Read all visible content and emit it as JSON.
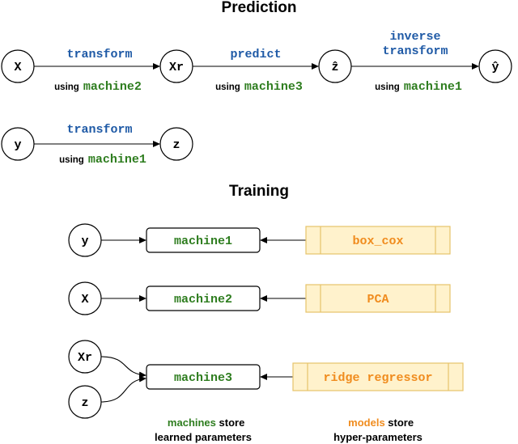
{
  "colors": {
    "operation": "#1f5aa6",
    "machine": "#2e7d1f",
    "model": "#f08c1e",
    "model_fill": "#fff2cc",
    "model_border": "#e6c36a"
  },
  "prediction": {
    "title": "Prediction",
    "row1": {
      "nodes": [
        "X",
        "Xr",
        "ẑ",
        "ŷ"
      ],
      "edges": [
        {
          "op": "transform",
          "using": "using",
          "machine": "machine2"
        },
        {
          "op": "predict",
          "using": "using",
          "machine": "machine3"
        },
        {
          "op_line1": "inverse",
          "op_line2": "transform",
          "using": "using",
          "machine": "machine1"
        }
      ]
    },
    "row2": {
      "nodes": [
        "y",
        "z"
      ],
      "edges": [
        {
          "op": "transform",
          "using": "using",
          "machine": "machine1"
        }
      ]
    }
  },
  "training": {
    "title": "Training",
    "rows": [
      {
        "inputs": [
          "y"
        ],
        "machine": "machine1",
        "model": "box_cox"
      },
      {
        "inputs": [
          "X"
        ],
        "machine": "machine2",
        "model": "PCA"
      },
      {
        "inputs": [
          "Xr",
          "z"
        ],
        "machine": "machine3",
        "model": "ridge regressor"
      }
    ]
  },
  "legend": {
    "machines": {
      "highlight": "machines",
      "rest1": " store",
      "line2": "learned parameters"
    },
    "models": {
      "highlight": "models",
      "rest1": " store",
      "line2": "hyper-parameters"
    }
  }
}
